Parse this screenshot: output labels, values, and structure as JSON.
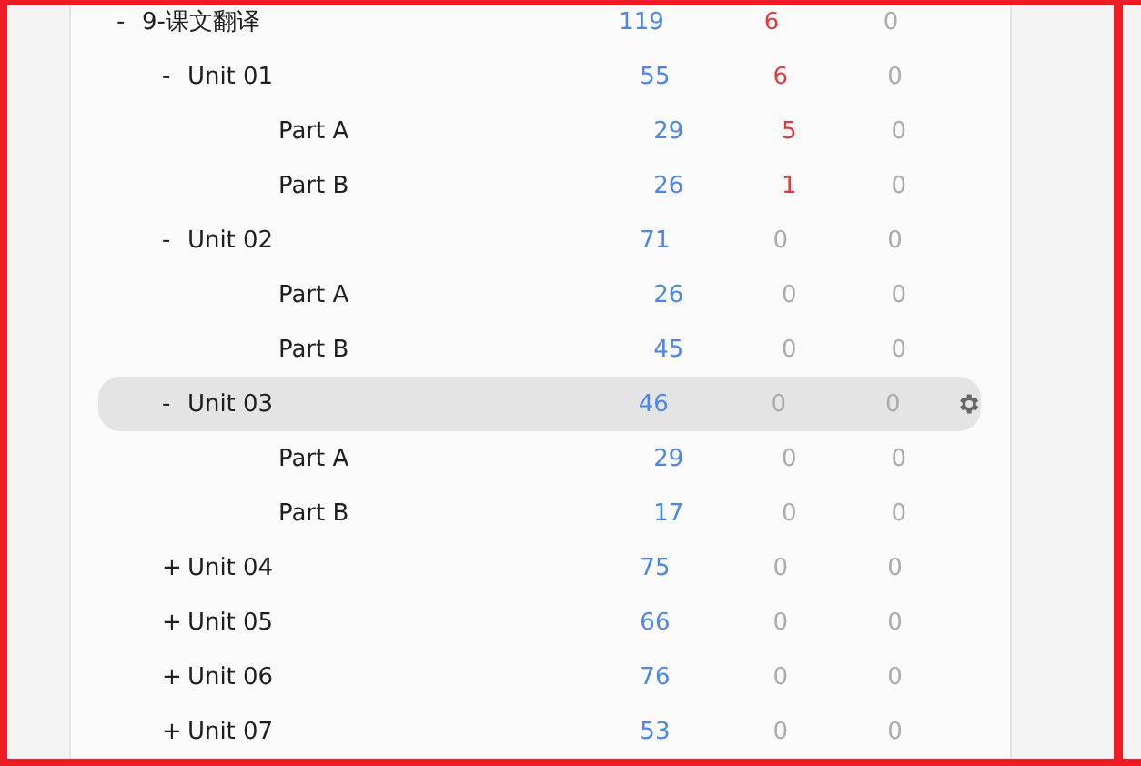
{
  "tree": [
    {
      "toggle": "-",
      "label": "9-课文翻译",
      "values": [
        "119",
        "6",
        "0"
      ],
      "alert": true,
      "selected": false,
      "children": [
        {
          "toggle": "-",
          "label": "Unit 01",
          "values": [
            "55",
            "6",
            "0"
          ],
          "alert": true,
          "selected": false,
          "children": [
            {
              "label": "Part A",
              "values": [
                "29",
                "5",
                "0"
              ],
              "alert": true,
              "selected": false
            },
            {
              "label": "Part B",
              "values": [
                "26",
                "1",
                "0"
              ],
              "alert": true,
              "selected": false
            }
          ]
        },
        {
          "toggle": "-",
          "label": "Unit 02",
          "values": [
            "71",
            "0",
            "0"
          ],
          "alert": false,
          "selected": false,
          "children": [
            {
              "label": "Part A",
              "values": [
                "26",
                "0",
                "0"
              ],
              "alert": false,
              "selected": false
            },
            {
              "label": "Part B",
              "values": [
                "45",
                "0",
                "0"
              ],
              "alert": false,
              "selected": false
            }
          ]
        },
        {
          "toggle": "-",
          "label": "Unit 03",
          "values": [
            "46",
            "0",
            "0"
          ],
          "alert": false,
          "selected": true,
          "children": [
            {
              "label": "Part A",
              "values": [
                "29",
                "0",
                "0"
              ],
              "alert": false,
              "selected": false
            },
            {
              "label": "Part B",
              "values": [
                "17",
                "0",
                "0"
              ],
              "alert": false,
              "selected": false
            }
          ]
        },
        {
          "toggle": "+",
          "label": "Unit 04",
          "values": [
            "75",
            "0",
            "0"
          ],
          "alert": false,
          "selected": false
        },
        {
          "toggle": "+",
          "label": "Unit 05",
          "values": [
            "66",
            "0",
            "0"
          ],
          "alert": false,
          "selected": false
        },
        {
          "toggle": "+",
          "label": "Unit 06",
          "values": [
            "76",
            "0",
            "0"
          ],
          "alert": false,
          "selected": false
        },
        {
          "toggle": "+",
          "label": "Unit 07",
          "values": [
            "53",
            "0",
            "0"
          ],
          "alert": false,
          "selected": false
        }
      ]
    }
  ]
}
